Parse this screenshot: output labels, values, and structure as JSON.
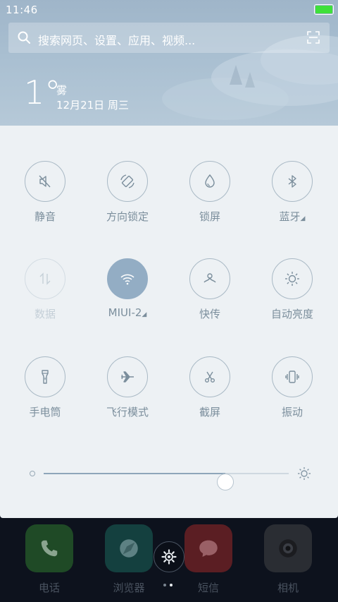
{
  "status_bar": {
    "time": "11:46",
    "battery_color": "#3ee03a"
  },
  "search": {
    "placeholder": "搜索网页、设置、应用、视频..."
  },
  "weather": {
    "temperature": "1°",
    "condition": "雾",
    "date": "12月21日 周三"
  },
  "toggles": [
    {
      "label": "静音",
      "icon": "mute-icon",
      "state": "off"
    },
    {
      "label": "方向锁定",
      "icon": "rotation-lock-icon",
      "state": "off"
    },
    {
      "label": "锁屏",
      "icon": "lock-screen-icon",
      "state": "off"
    },
    {
      "label": "蓝牙",
      "icon": "bluetooth-icon",
      "state": "off",
      "has_menu": true
    },
    {
      "label": "数据",
      "icon": "mobile-data-icon",
      "state": "disabled"
    },
    {
      "label": "MIUI-2",
      "icon": "wifi-icon",
      "state": "on",
      "has_menu": true
    },
    {
      "label": "快传",
      "icon": "quick-transfer-icon",
      "state": "off"
    },
    {
      "label": "自动亮度",
      "icon": "auto-brightness-icon",
      "state": "off"
    },
    {
      "label": "手电筒",
      "icon": "flashlight-icon",
      "state": "off"
    },
    {
      "label": "飞行模式",
      "icon": "airplane-icon",
      "state": "off"
    },
    {
      "label": "截屏",
      "icon": "screenshot-icon",
      "state": "off"
    },
    {
      "label": "振动",
      "icon": "vibrate-icon",
      "state": "off"
    }
  ],
  "brightness": {
    "level": 0.74
  },
  "dock": {
    "apps": [
      {
        "label": "电话",
        "icon": "phone-icon",
        "color": "#1f4a26"
      },
      {
        "label": "浏览器",
        "icon": "browser-icon",
        "color": "#14403f"
      },
      {
        "label": "短信",
        "icon": "message-icon",
        "color": "#5b1e23"
      },
      {
        "label": "相机",
        "icon": "camera-icon",
        "color": "#2a2d33"
      }
    ],
    "page_dots": 2,
    "active_page": 1
  },
  "colors": {
    "accent": "#93adc4",
    "panel_bg": "#edf1f4"
  }
}
